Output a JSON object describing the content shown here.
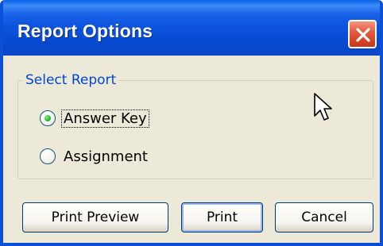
{
  "window": {
    "title": "Report Options",
    "close_icon": "close-icon"
  },
  "group": {
    "legend": "Select Report",
    "options": [
      {
        "label": "Answer Key",
        "selected": true
      },
      {
        "label": "Assignment",
        "selected": false
      }
    ]
  },
  "buttons": {
    "print_preview": "Print Preview",
    "print": "Print",
    "cancel": "Cancel"
  },
  "colors": {
    "titlebar": "#0a52dc",
    "close": "#e0573a",
    "legend": "#0046d5",
    "radio_dot": "#2eb52e",
    "dialog_bg": "#ece9d8"
  }
}
